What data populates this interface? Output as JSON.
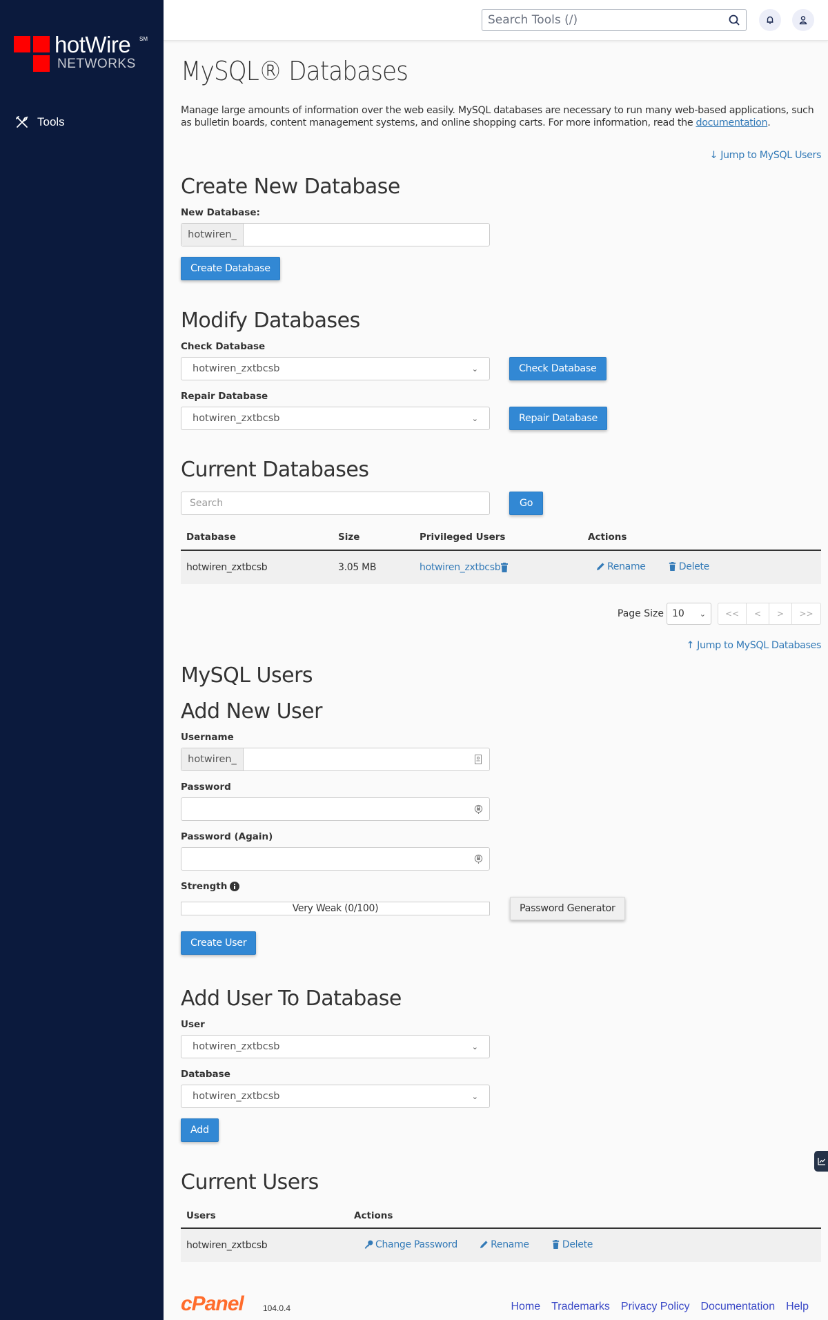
{
  "sidebar": {
    "brand": "hotWire",
    "brand_mark": "SM",
    "brand_sub": "NETWORKS",
    "items": [
      {
        "label": "Tools",
        "icon": "tools-icon"
      }
    ]
  },
  "header": {
    "search_placeholder": "Search Tools (/)"
  },
  "page": {
    "title": "MySQL® Databases",
    "intro": "Manage large amounts of information over the web easily. MySQL databases are necessary to run many web-based applications, such as bulletin boards, content management systems, and online shopping carts. For more information, read the ",
    "intro_link": "documentation",
    "intro_end": ".",
    "jump_users": "Jump to MySQL Users",
    "jump_databases": "Jump to MySQL Databases"
  },
  "create_db": {
    "heading": "Create New Database",
    "label": "New Database:",
    "prefix": "hotwiren_",
    "value": "",
    "button": "Create Database"
  },
  "modify_db": {
    "heading": "Modify Databases",
    "check_label": "Check Database",
    "check_value": "hotwiren_zxtbcsb",
    "check_button": "Check Database",
    "repair_label": "Repair Database",
    "repair_value": "hotwiren_zxtbcsb",
    "repair_button": "Repair Database"
  },
  "current_db": {
    "heading": "Current Databases",
    "search_placeholder": "Search",
    "go_button": "Go",
    "columns": [
      "Database",
      "Size",
      "Privileged Users",
      "Actions"
    ],
    "rows": [
      {
        "database": "hotwiren_zxtbcsb",
        "size": "3.05 MB",
        "user": "hotwiren_zxtbcsb",
        "rename": "Rename",
        "delete": "Delete"
      }
    ],
    "page_size_label": "Page Size",
    "page_size": "10",
    "pager": [
      "<<",
      "<",
      ">",
      ">>"
    ]
  },
  "users": {
    "heading": "MySQL Users",
    "add_heading": "Add New User",
    "username_label": "Username",
    "username_prefix": "hotwiren_",
    "password_label": "Password",
    "password_again_label": "Password (Again)",
    "strength_label": "Strength",
    "strength_text": "Very Weak (0/100)",
    "strength_value": 0,
    "generator_button": "Password Generator",
    "create_button": "Create User"
  },
  "add_user_db": {
    "heading": "Add User To Database",
    "user_label": "User",
    "user_value": "hotwiren_zxtbcsb",
    "db_label": "Database",
    "db_value": "hotwiren_zxtbcsb",
    "add_button": "Add"
  },
  "current_users": {
    "heading": "Current Users",
    "columns": [
      "Users",
      "Actions"
    ],
    "rows": [
      {
        "user": "hotwiren_zxtbcsb",
        "change_password": "Change Password",
        "rename": "Rename",
        "delete": "Delete"
      }
    ]
  },
  "footer": {
    "logo": "cPanel",
    "version": "104.0.4",
    "links": [
      "Home",
      "Trademarks",
      "Privacy Policy",
      "Documentation",
      "Help"
    ]
  }
}
